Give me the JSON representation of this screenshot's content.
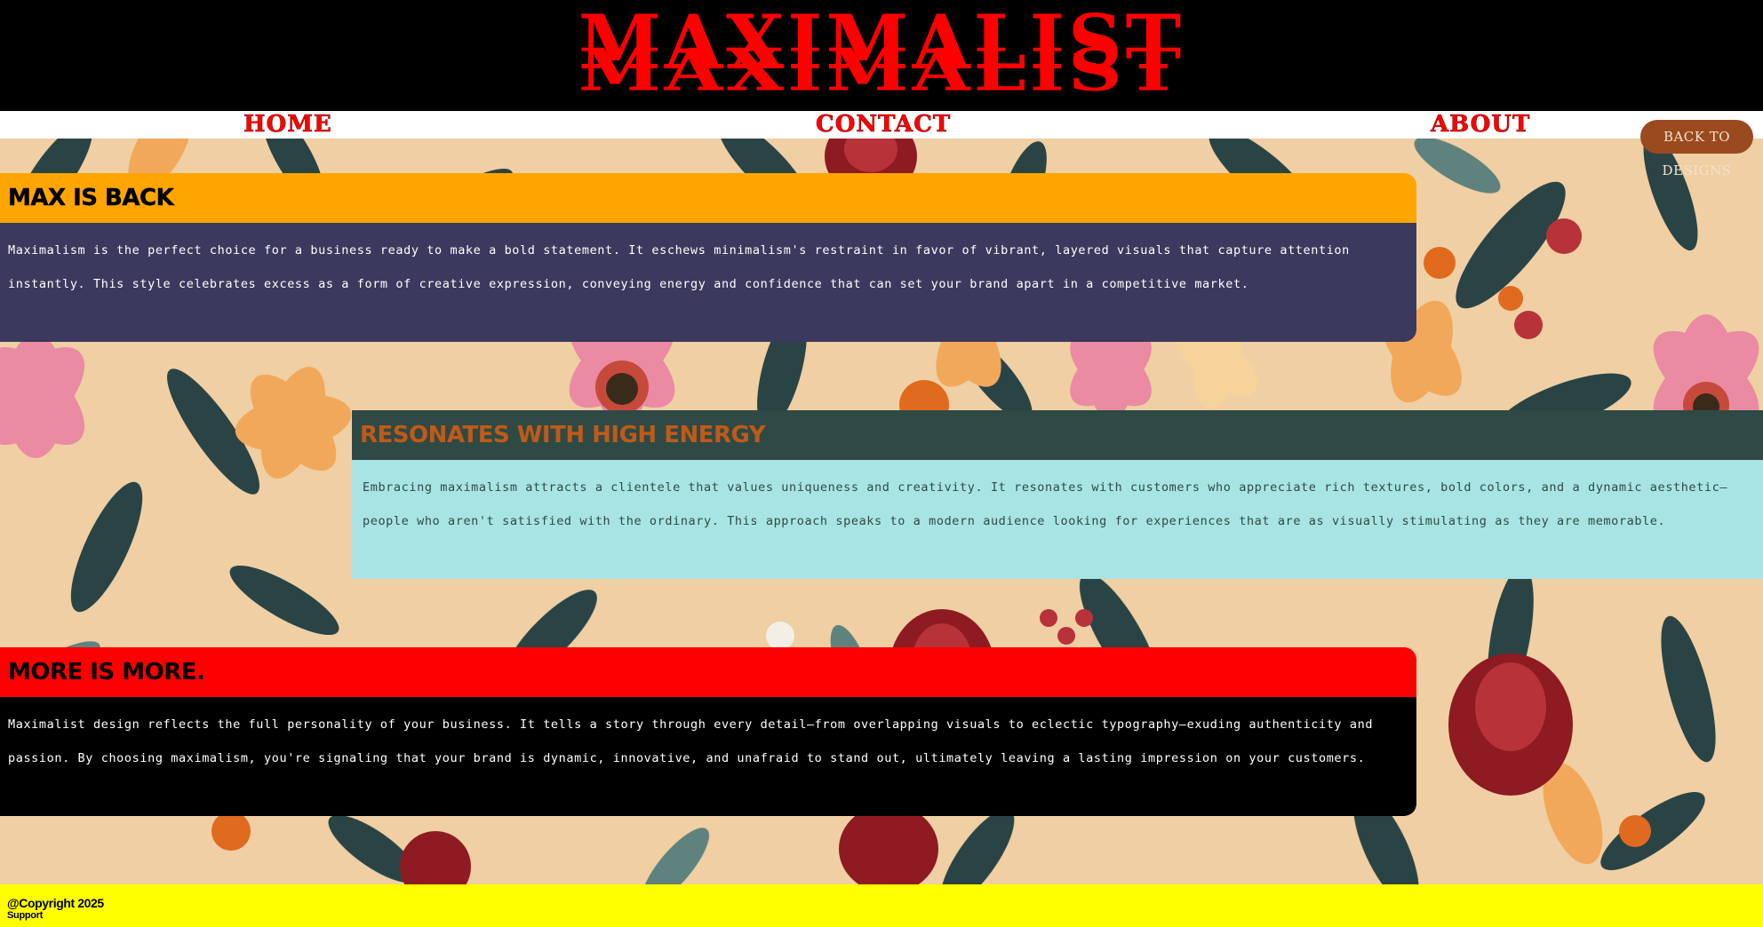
{
  "header": {
    "logo": "MAXIMALIST"
  },
  "nav": {
    "home": "HOME",
    "contact": "CONTACT",
    "about": "ABOUT"
  },
  "back_button": "BACK TO DESIGNS",
  "sections": [
    {
      "heading": "MAX IS BACK",
      "body": "Maximalism is the perfect choice for a business ready to make a bold statement. It eschews minimalism's restraint in favor of vibrant, layered visuals that capture attention instantly. This style celebrates excess as a form of creative expression, conveying energy and confidence that can set your brand apart in a competitive market."
    },
    {
      "heading": "RESONATES WITH HIGH ENERGY",
      "body": "Embracing maximalism attracts a clientele that values uniqueness and creativity. It resonates with customers who appreciate rich textures, bold colors, and a dynamic aesthetic—people who aren't satisfied with the ordinary. This approach speaks to a modern audience looking for experiences that are as visually stimulating as they are memorable."
    },
    {
      "heading": "MORE IS MORE.",
      "body": "Maximalist design reflects the full personality of your business. It tells a story through every detail—from overlapping visuals to eclectic typography—exuding authenticity and passion. By choosing maximalism, you're signaling that your brand is dynamic, innovative, and unafraid to stand out, ultimately leaving a lasting impression on your customers."
    }
  ],
  "footer": {
    "copyright": "@Copyright 2025",
    "support": "Support"
  },
  "colors": {
    "logo": "#ff0000",
    "nav_link": "#ff0000",
    "back_button": "#9b4a20",
    "section1_head": "#ffa500",
    "section1_body": "#3b395d",
    "section2_head": "#2f4a45",
    "section2_head_text": "#c05a18",
    "section2_body": "#a8e4e4",
    "section3_head": "#ff0000",
    "section3_body": "#000000",
    "footer": "#ffff00"
  }
}
